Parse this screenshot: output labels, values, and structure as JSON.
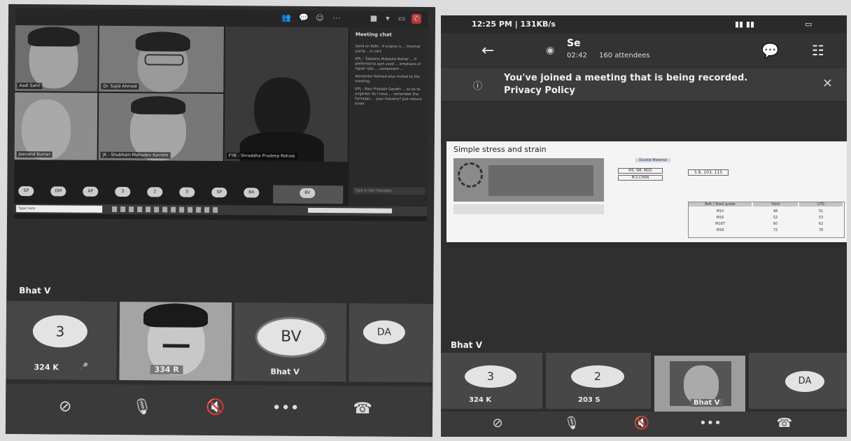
{
  "left_screen": {
    "chat_title": "Meeting chat",
    "chat_messages": [
      "Send on Kafe - if engine is ... thermal pump ...in cars",
      "KPL - Tubeless Rubashe Kumar ... if preferred to part used ... emphasis of repair rate ... component ...",
      "Alexander Kolmad also invited to the meeting",
      "KPL - Ravi Prakash Gandhi ... so as to engineer do I have ... remember the formulas ... your industry? Just reduce knew"
    ],
    "chat_input_placeholder": "Type a new message",
    "participants": [
      {
        "name": "Aadi Sahil"
      },
      {
        "name": "Dr. Sajid Ahmed"
      },
      {
        "name": "Jeevand Kumar"
      },
      {
        "name": "JK - Shubham Mahadev Kamble"
      },
      {
        "name": "FYB - Shraddha Pradeep Rohale"
      }
    ],
    "chips": [
      "SP",
      "DM",
      "AP",
      "3",
      "2",
      "5",
      "SP",
      "BA",
      "BV"
    ],
    "taskbar_search": "Type here"
  },
  "left_phone": {
    "active_speaker": "Bhat V",
    "tiles": [
      {
        "avatar": "3",
        "caption": "324 K"
      },
      {
        "avatar": "",
        "caption": "334 R"
      },
      {
        "avatar": "BV",
        "caption": "Bhat V"
      },
      {
        "avatar": "DA",
        "caption": ""
      }
    ],
    "controls": [
      "video-off-icon",
      "mic-off-icon",
      "speaker-off-icon",
      "more-icon",
      "hang-up-icon"
    ]
  },
  "right_phone": {
    "status_time": "12:25 PM | 131KB/s",
    "meeting_title": "Se",
    "meeting_time": "02:42",
    "attendees": "160 attendees",
    "banner_text": "You've joined a meeting that is being recorded.",
    "banner_link": "Privacy Policy",
    "slide_title": "Simple stress and strain",
    "slide_labels": [
      "Ductile Material",
      "MS, SM, MOD",
      "M.S.CHAN",
      "5.8, 203, 115"
    ],
    "slide_table_header": [
      "Bolt / Steel grade",
      "Yield",
      "UTS"
    ],
    "slide_table_rows": [
      [
        "M10",
        "48",
        "51"
      ],
      [
        "M16",
        "52",
        "53"
      ],
      [
        "M16T",
        "60",
        "62"
      ],
      [
        "M18",
        "72",
        "78"
      ]
    ],
    "speaker_name": "Bhat V",
    "tiles": [
      {
        "avatar": "3",
        "caption": "324 K"
      },
      {
        "avatar": "2",
        "caption": "203 S"
      },
      {
        "avatar": "",
        "caption": "Bhat V"
      },
      {
        "avatar": "DA",
        "caption": ""
      }
    ]
  }
}
